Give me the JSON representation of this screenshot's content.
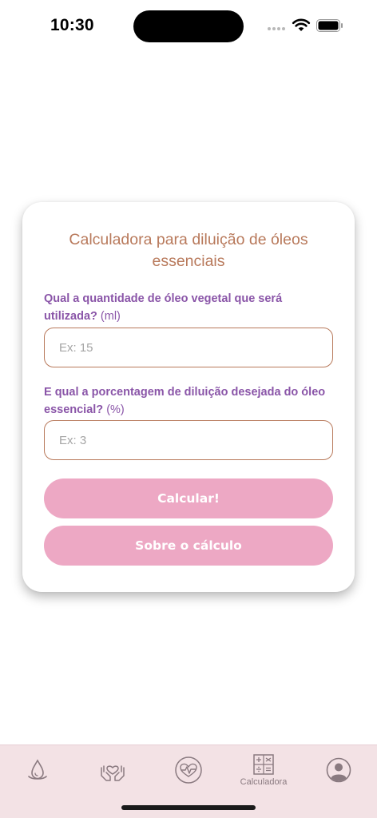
{
  "status_bar": {
    "time": "10:30"
  },
  "calculator": {
    "title": "Calculadora para diluição de óleos essenciais",
    "question_volume": "Qual a quantidade de óleo vegetal que será utilizada?",
    "question_volume_unit": "(ml)",
    "volume_placeholder": "Ex: 15",
    "question_percentage": "E qual a porcentagem de diluição desejada do óleo essencial?",
    "question_percentage_unit": "(%)",
    "percentage_placeholder": "Ex: 3",
    "calculate_label": "Calcular!",
    "about_label": "Sobre o cálculo"
  },
  "tab_bar": {
    "active_tab": "calculadora",
    "items": [
      {
        "icon": "drop-icon",
        "label": ""
      },
      {
        "icon": "hands-heart-icon",
        "label": ""
      },
      {
        "icon": "heartbeat-icon",
        "label": ""
      },
      {
        "icon": "calculator-icon",
        "label": "Calculadora"
      },
      {
        "icon": "profile-icon",
        "label": ""
      }
    ]
  },
  "colors": {
    "title": "#b8795b",
    "question": "#8a55a8",
    "field_border": "#b8795b",
    "button": "#eda8c4",
    "tab_bar_bg": "#f3e2e5",
    "tab_icon": "#8a7a80"
  }
}
